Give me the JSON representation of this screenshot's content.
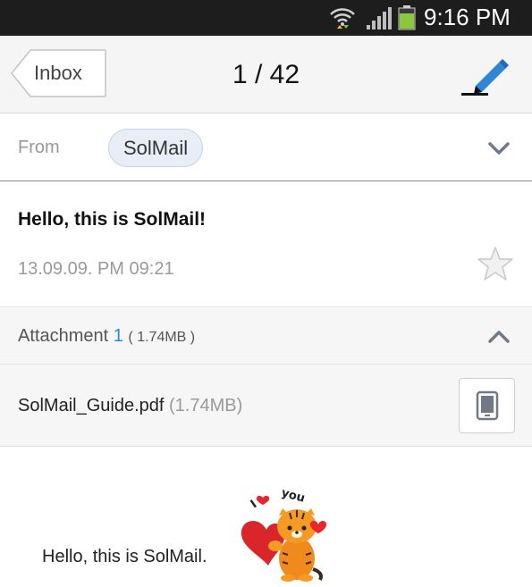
{
  "status_bar": {
    "time": "9:16 PM",
    "icons": [
      "wifi-icon",
      "signal-icon",
      "battery-icon"
    ]
  },
  "toolbar": {
    "back_label": "Inbox",
    "counter": "1 / 42",
    "compose_icon": "pencil-icon"
  },
  "header": {
    "from_label": "From",
    "sender": "SolMail",
    "expand_icon": "chevron-down-icon"
  },
  "message": {
    "subject": "Hello, this is SolMail!",
    "date": "13.09.09. PM 09:21",
    "star_icon": "star-icon"
  },
  "attachments": {
    "label": "Attachment",
    "count": "1",
    "total_size": "( 1.74MB )",
    "collapse_icon": "chevron-up-icon",
    "items": [
      {
        "name": "SolMail_Guide.pdf",
        "size": "(1.74MB)",
        "action_icon": "phone-save-icon"
      }
    ]
  },
  "body": {
    "text": "Hello, this is SolMail.",
    "sticker": {
      "icon": "tiger-love-sticker",
      "caption": "I love you"
    }
  },
  "colors": {
    "status_bar": "#1d1d1d",
    "accent_blue": "#2f86d6",
    "chip_bg": "#e8eef7",
    "section_bg": "#f6f6f6",
    "battery_green": "#8bc63f"
  }
}
